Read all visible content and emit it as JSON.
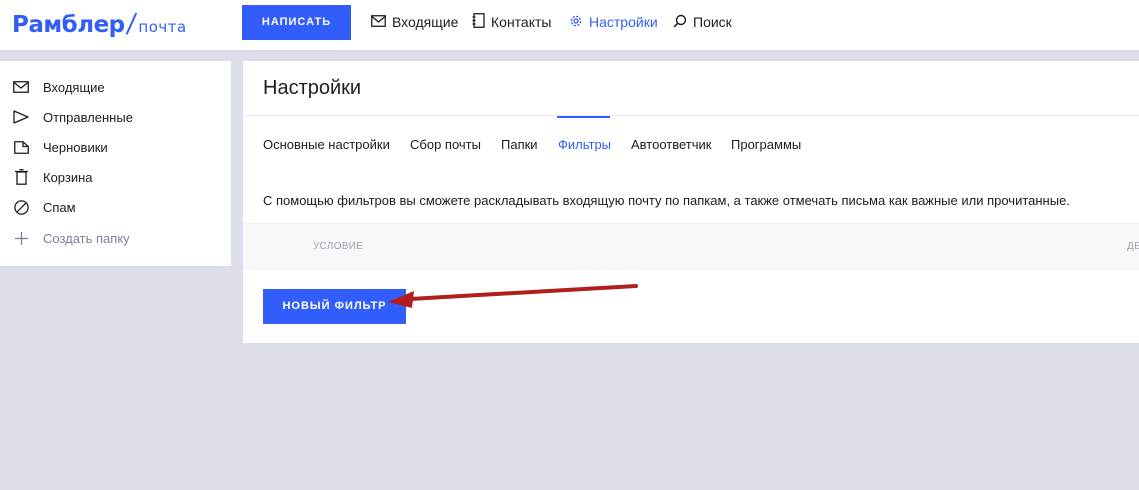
{
  "logo": {
    "main": "Рамблер",
    "slash": "/",
    "sub": "почта"
  },
  "header": {
    "compose_label": "НАПИСАТЬ",
    "nav": [
      {
        "label": "Входящие",
        "icon": "envelope-icon"
      },
      {
        "label": "Контакты",
        "icon": "contacts-book-icon"
      },
      {
        "label": "Настройки",
        "icon": "gear-icon",
        "active": true
      },
      {
        "label": "Поиск",
        "icon": "search-icon"
      }
    ]
  },
  "sidebar": {
    "items": [
      {
        "label": "Входящие",
        "icon": "envelope-icon"
      },
      {
        "label": "Отправленные",
        "icon": "send-arrow-icon"
      },
      {
        "label": "Черновики",
        "icon": "draft-document-icon"
      },
      {
        "label": "Корзина",
        "icon": "trash-icon"
      },
      {
        "label": "Спам",
        "icon": "spam-circle-icon"
      },
      {
        "label": "Создать папку",
        "icon": "plus-icon"
      }
    ]
  },
  "main": {
    "title": "Настройки",
    "tabs": [
      {
        "label": "Основные настройки"
      },
      {
        "label": "Сбор почты"
      },
      {
        "label": "Папки"
      },
      {
        "label": "Фильтры",
        "active": true
      },
      {
        "label": "Автоответчик"
      },
      {
        "label": "Программы"
      }
    ],
    "info_text": "С помощью фильтров вы сможете раскладывать входящую почту по папкам, а также отмечать письма как важные или прочитанные.",
    "table_headers": {
      "condition": "УСЛОВИЕ",
      "action": "ДЕ"
    },
    "new_filter_label": "НОВЫЙ ФИЛЬТР"
  },
  "colors": {
    "accent": "#315efb",
    "background": "#dcdfea",
    "annotation_arrow": "#b01e1e"
  }
}
